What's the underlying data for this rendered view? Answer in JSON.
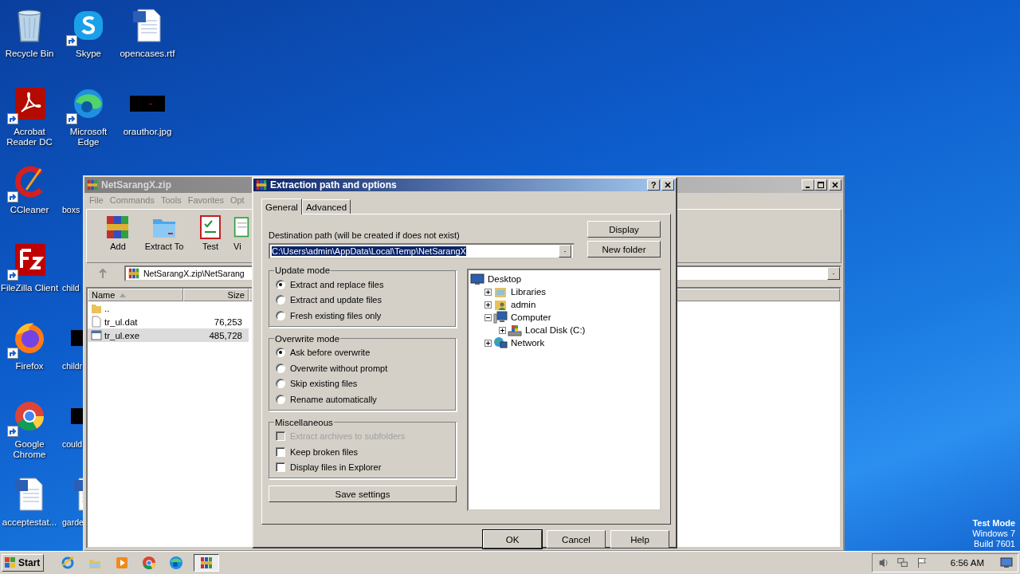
{
  "desktop": {
    "icon_rows": [
      [
        {
          "label": "Recycle Bin",
          "kind": "recycle",
          "shortcut": false,
          "covered": false
        },
        {
          "label": "Skype",
          "kind": "skype",
          "shortcut": true,
          "covered": false
        },
        {
          "label": "opencases.rtf",
          "kind": "word",
          "shortcut": false,
          "covered": false
        }
      ],
      [
        {
          "label": "Acrobat Reader DC",
          "kind": "acrobat",
          "shortcut": true,
          "covered": false
        },
        {
          "label": "Microsoft Edge",
          "kind": "edge",
          "shortcut": true,
          "covered": false
        },
        {
          "label": "orauthor.jpg",
          "kind": "photo",
          "shortcut": false,
          "covered": false
        }
      ],
      [
        {
          "label": "CCleaner",
          "kind": "ccleaner",
          "shortcut": true,
          "covered": false
        },
        {
          "label": "boxs",
          "kind": "blank",
          "shortcut": false,
          "covered": true
        }
      ],
      [
        {
          "label": "FileZilla Client",
          "kind": "filezilla",
          "shortcut": true,
          "covered": false
        },
        {
          "label": "child",
          "kind": "blank",
          "shortcut": false,
          "covered": true
        }
      ],
      [
        {
          "label": "Firefox",
          "kind": "firefox",
          "shortcut": true,
          "covered": false
        },
        {
          "label": "childr",
          "kind": "photo",
          "shortcut": false,
          "covered": true
        }
      ],
      [
        {
          "label": "Google Chrome",
          "kind": "chrome",
          "shortcut": true,
          "covered": false
        },
        {
          "label": "could",
          "kind": "photo",
          "shortcut": false,
          "covered": true
        }
      ],
      [
        {
          "label": "acceptestat...",
          "kind": "word",
          "shortcut": false,
          "covered": false
        },
        {
          "label": "garde",
          "kind": "word",
          "shortcut": false,
          "covered": true
        }
      ]
    ],
    "os_notice": [
      "Test Mode",
      "Windows 7",
      "Build 7601"
    ]
  },
  "archive_window": {
    "title": "NetSarangX.zip",
    "active": false,
    "menu": [
      "File",
      "Commands",
      "Tools",
      "Favorites",
      "Opt"
    ],
    "toolbar": [
      {
        "label": "Add",
        "kind": "add"
      },
      {
        "label": "Extract To",
        "kind": "extract"
      },
      {
        "label": "Test",
        "kind": "test"
      },
      {
        "label": "Vi",
        "kind": "view"
      }
    ],
    "address": "NetSarangX.zip\\NetSarang",
    "columns": [
      "Name",
      "Size"
    ],
    "rows": [
      {
        "name": "..",
        "kind": "folder",
        "selected": false
      },
      {
        "name": "tr_ul.dat",
        "size": "76,253",
        "kind": "file",
        "selected": false
      },
      {
        "name": "tr_ul.exe",
        "size": "485,728",
        "kind": "exe",
        "selected": true
      }
    ]
  },
  "dialog": {
    "title": "Extraction path and options",
    "active": true,
    "help_button": "?",
    "tabs": [
      {
        "label": "General",
        "selected": true
      },
      {
        "label": "Advanced",
        "selected": false
      }
    ],
    "destination_label": "Destination path (will be created if does not exist)",
    "destination_path": {
      "value": "C:\\Users\\admin\\AppData\\Local\\Temp\\NetSarangX",
      "text_selected": true
    },
    "side_buttons": [
      "Display",
      "New folder"
    ],
    "update_mode": {
      "title": "Update mode",
      "options": [
        {
          "label": "Extract and replace files",
          "selected": true
        },
        {
          "label": "Extract and update files",
          "selected": false
        },
        {
          "label": "Fresh existing files only",
          "selected": false
        }
      ]
    },
    "overwrite_mode": {
      "title": "Overwrite mode",
      "options": [
        {
          "label": "Ask before overwrite",
          "selected": true
        },
        {
          "label": "Overwrite without prompt",
          "selected": false
        },
        {
          "label": "Skip existing files",
          "selected": false
        },
        {
          "label": "Rename automatically",
          "selected": false
        }
      ]
    },
    "miscellaneous": {
      "title": "Miscellaneous",
      "options": [
        {
          "label": "Extract archives to subfolders",
          "checked": false,
          "disabled": true
        },
        {
          "label": "Keep broken files",
          "checked": false,
          "disabled": false
        },
        {
          "label": "Display files in Explorer",
          "checked": false,
          "disabled": false
        }
      ]
    },
    "save_button": "Save settings",
    "tree": [
      {
        "label": "Desktop",
        "kind": "desktop",
        "children": [
          {
            "label": "Libraries",
            "kind": "libraries",
            "expanded": false
          },
          {
            "label": "admin",
            "kind": "user",
            "expanded": false
          },
          {
            "label": "Computer",
            "kind": "computer",
            "expanded": true,
            "children": [
              {
                "label": "Local Disk (C:)",
                "kind": "disk",
                "expanded": false
              }
            ]
          },
          {
            "label": "Network",
            "kind": "network",
            "expanded": false
          }
        ]
      }
    ],
    "buttons": [
      {
        "label": "OK",
        "default": true
      },
      {
        "label": "Cancel",
        "default": false
      },
      {
        "label": "Help",
        "default": false
      }
    ]
  },
  "taskbar": {
    "start": "Start",
    "items": [
      {
        "kind": "ie",
        "selected": false
      },
      {
        "kind": "explorer",
        "selected": false
      },
      {
        "kind": "media",
        "selected": false
      },
      {
        "kind": "chrome",
        "selected": false
      },
      {
        "kind": "edge",
        "selected": false
      },
      {
        "kind": "winrar",
        "selected": true
      }
    ],
    "tray": [
      {
        "kind": "speaker"
      },
      {
        "kind": "network"
      },
      {
        "kind": "flag"
      }
    ],
    "clock": "6:56 AM"
  }
}
